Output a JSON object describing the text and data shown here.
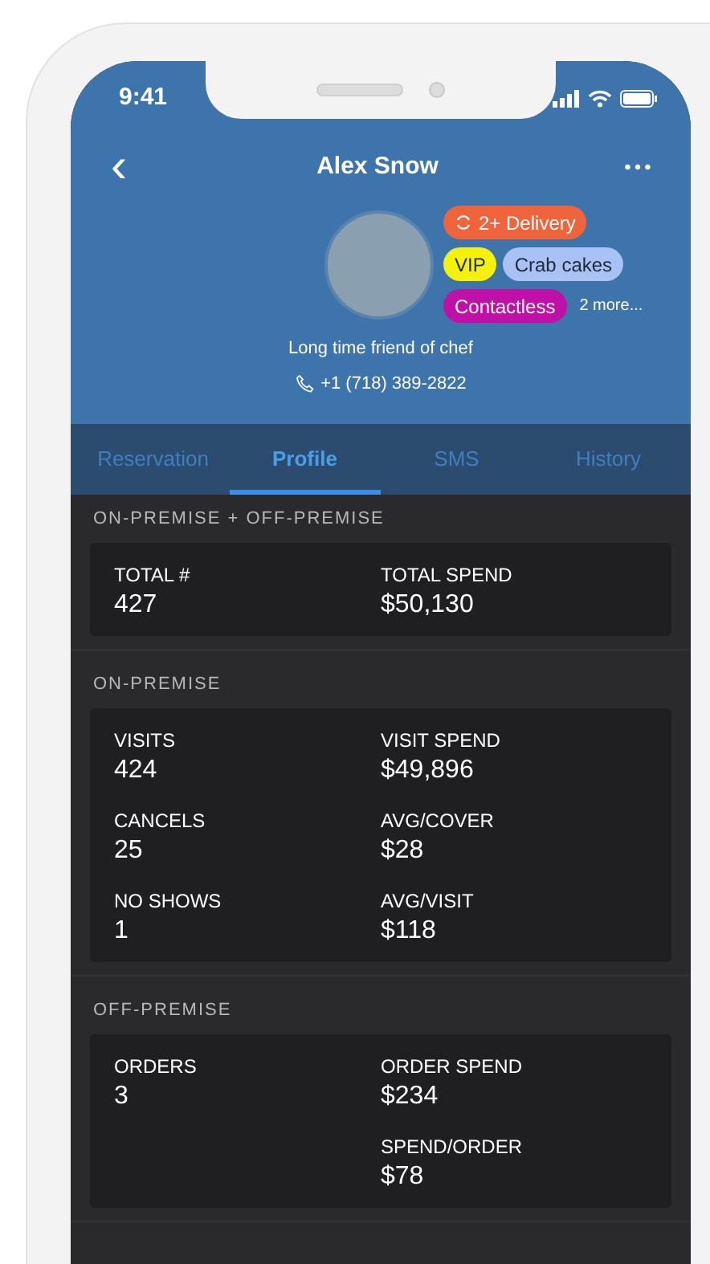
{
  "status_bar": {
    "time": "9:41"
  },
  "header": {
    "back": "‹",
    "title": "Alex Snow",
    "more": "•••"
  },
  "profile": {
    "tag_rows": [
      [
        {
          "label": "2+ Delivery",
          "color": "#f0643c",
          "kind": "repeat"
        }
      ],
      [
        {
          "label": "VIP",
          "color": "#f5f10a",
          "kind": "plain"
        },
        {
          "label": "Crab cakes",
          "color": "#a9c2f5",
          "kind": "plain"
        }
      ],
      [
        {
          "label": "Contactless",
          "color": "#c010a8",
          "kind": "plain"
        }
      ]
    ],
    "more_tags": "2 more...",
    "note": "Long time friend of chef",
    "phone": "+1 (718) 389-2822"
  },
  "tabs": [
    {
      "label": "Reservation",
      "selected": false
    },
    {
      "label": "Profile",
      "selected": true
    },
    {
      "label": "SMS",
      "selected": false
    },
    {
      "label": "History",
      "selected": false
    }
  ],
  "sections": [
    {
      "title": "ON-PREMISE + OFF-PREMISE",
      "rows": [
        {
          "left": {
            "label": "TOTAL #",
            "value": "427"
          },
          "right": {
            "label": "TOTAL SPEND",
            "value": "$50,130"
          }
        }
      ]
    },
    {
      "title": "ON-PREMISE",
      "rows": [
        {
          "left": {
            "label": "VISITS",
            "value": "424"
          },
          "right": {
            "label": "VISIT SPEND",
            "value": "$49,896"
          }
        },
        {
          "left": {
            "label": "CANCELS",
            "value": "25"
          },
          "right": {
            "label": "AVG/COVER",
            "value": "$28"
          }
        },
        {
          "left": {
            "label": "NO SHOWS",
            "value": "1"
          },
          "right": {
            "label": "AVG/VISIT",
            "value": "$118"
          }
        }
      ]
    },
    {
      "title": "OFF-PREMISE",
      "rows": [
        {
          "left": {
            "label": "ORDERS",
            "value": "3"
          },
          "right": {
            "label": "ORDER SPEND",
            "value": "$234"
          }
        },
        {
          "right": {
            "label": "SPEND/ORDER",
            "value": "$78"
          }
        }
      ]
    }
  ]
}
